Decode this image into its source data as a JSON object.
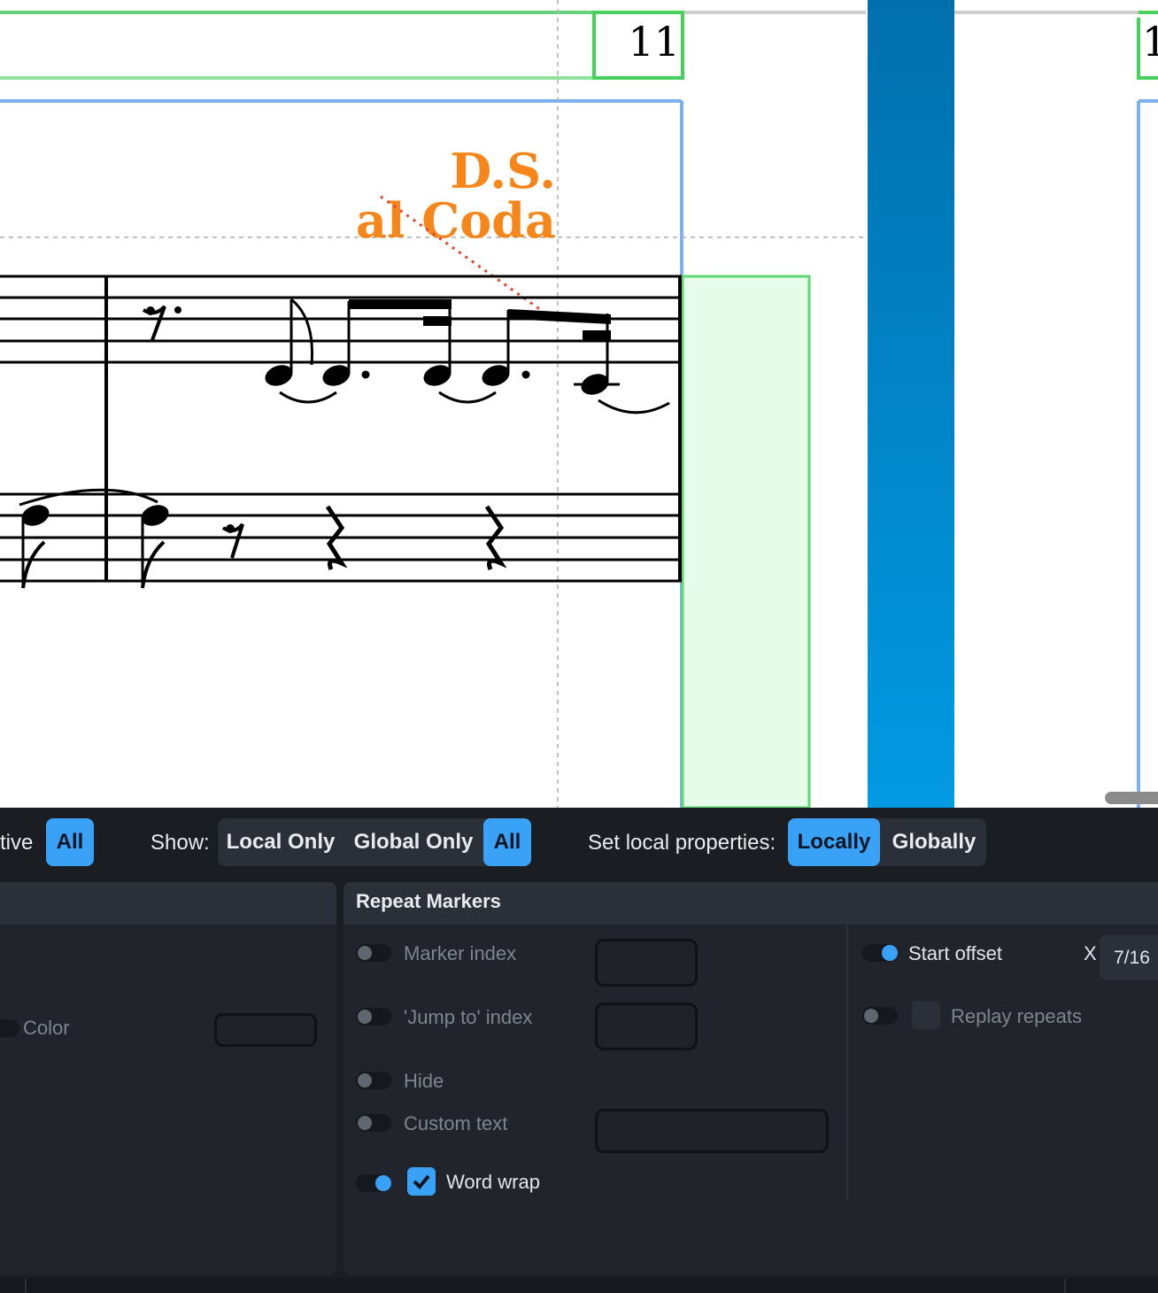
{
  "score": {
    "measure_number": "11",
    "measure_number_next": "1",
    "marker_line1": "D.S.",
    "marker_line2": "al Coda",
    "marker_color": "#f6861a"
  },
  "toolbar": {
    "partial_label": "tive",
    "filter_all": "All",
    "show_label": "Show:",
    "local_only": "Local Only",
    "global_only": "Global Only",
    "show_all": "All",
    "set_local_label": "Set local properties:",
    "locally": "Locally",
    "globally": "Globally",
    "accent": "#3aa2f6"
  },
  "left_card": {
    "color_label": "Color"
  },
  "repeat_markers": {
    "title": "Repeat Markers",
    "marker_index": "Marker index",
    "jump_to_index": "'Jump to' index",
    "hide": "Hide",
    "custom_text": "Custom text",
    "word_wrap": "Word wrap",
    "word_wrap_checked": true,
    "start_offset": "Start offset",
    "start_offset_axis": "X",
    "start_offset_value": "7/16",
    "replay_repeats": "Replay repeats"
  }
}
